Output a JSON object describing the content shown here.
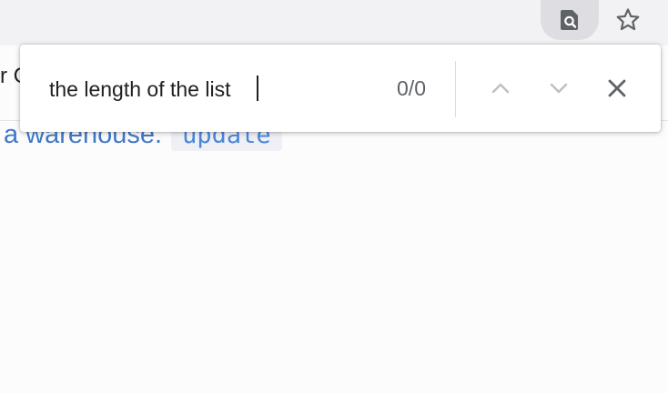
{
  "browser_toolbar": {
    "find_icon": "find-in-page-icon",
    "bookmark_icon": "star-outline-icon"
  },
  "page": {
    "partial_left_text": "r C",
    "headline_text": "a warehouse.",
    "code_chip_text": "update"
  },
  "find_bar": {
    "query": "the length of the list",
    "match_count": "0/0",
    "prev_icon": "chevron-up-icon",
    "next_icon": "chevron-down-icon",
    "close_icon": "close-icon"
  },
  "colors": {
    "toolbar_bg": "#f2f2f4",
    "active_button_bg": "#dedee2",
    "link_blue": "#3f78c8",
    "chip_bg": "#eef0f6",
    "text_dark": "#202124",
    "text_muted": "#5f6368"
  }
}
